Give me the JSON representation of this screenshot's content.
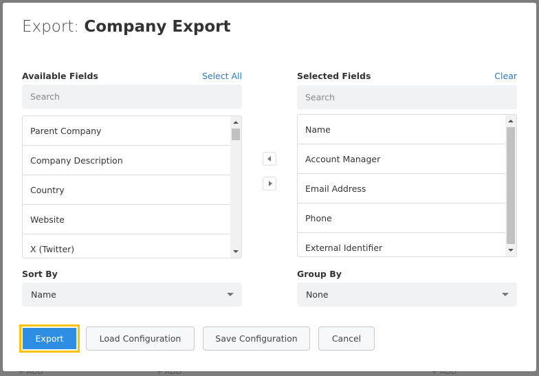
{
  "background": {
    "add_labels": [
      "+ ADD",
      "+ ADD",
      "+ ADD"
    ]
  },
  "dialog": {
    "title_prefix": "Export:",
    "title_name": "Company Export"
  },
  "available": {
    "label": "Available Fields",
    "select_all": "Select All",
    "search_placeholder": "Search",
    "items": [
      "Parent Company",
      "Company Description",
      "Country",
      "Website",
      "X (Twitter)"
    ]
  },
  "selected": {
    "label": "Selected Fields",
    "clear": "Clear",
    "search_placeholder": "Search",
    "items": [
      "Name",
      "Account Manager",
      "Email Address",
      "Phone",
      "External Identifier"
    ]
  },
  "sort": {
    "label": "Sort By",
    "value": "Name"
  },
  "group": {
    "label": "Group By",
    "value": "None"
  },
  "buttons": {
    "export": "Export",
    "load": "Load Configuration",
    "save": "Save Configuration",
    "cancel": "Cancel"
  },
  "colors": {
    "primary": "#2d8ee3",
    "focus": "#f9c300",
    "link": "#2a7ac0"
  }
}
